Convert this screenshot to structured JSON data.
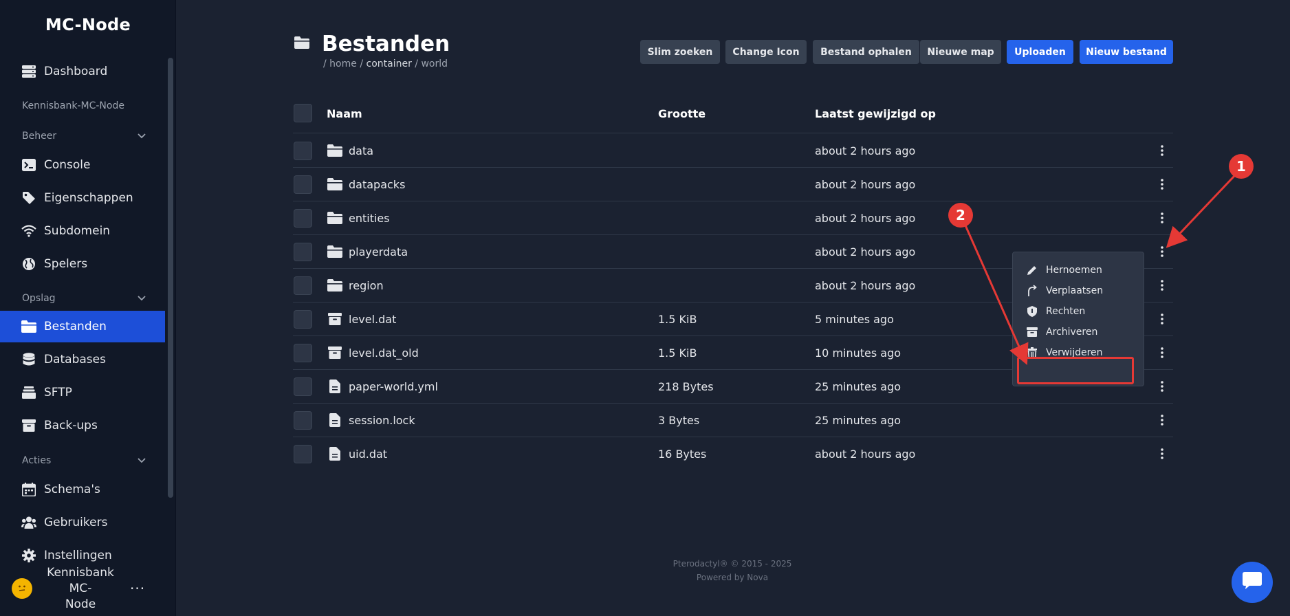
{
  "brand": "MC-Node",
  "sidebar": {
    "items": [
      {
        "label": "Dashboard",
        "icon": "server-icon"
      },
      {
        "label": "Console",
        "icon": "terminal-icon"
      },
      {
        "label": "Eigenschappen",
        "icon": "tag-icon"
      },
      {
        "label": "Subdomein",
        "icon": "wifi-icon"
      },
      {
        "label": "Spelers",
        "icon": "globe-icon"
      },
      {
        "label": "Bestanden",
        "icon": "folder-icon",
        "active": true
      },
      {
        "label": "Databases",
        "icon": "database-icon"
      },
      {
        "label": "SFTP",
        "icon": "stack-icon"
      },
      {
        "label": "Back-ups",
        "icon": "archive-icon"
      },
      {
        "label": "Schema's",
        "icon": "calendar-icon"
      },
      {
        "label": "Gebruikers",
        "icon": "users-icon"
      },
      {
        "label": "Instellingen",
        "icon": "gear-icon"
      }
    ],
    "server_name": "Kennisbank-MC-Node",
    "sections": {
      "beheer": "Beheer",
      "opslag": "Opslag",
      "acties": "Acties"
    },
    "user": {
      "name_line1": "Kennisbank MC-",
      "name_line2": "Node",
      "menu": "···"
    }
  },
  "header": {
    "title": "Bestanden",
    "breadcrumb": {
      "sep1": "/ ",
      "home": "home",
      "sep2": " / ",
      "container": "container",
      "sep3": " / ",
      "world": "world"
    }
  },
  "toolbar": {
    "smart_search": "Slim zoeken",
    "change_icon": "Change Icon",
    "fetch_file": "Bestand ophalen",
    "new_folder": "Nieuwe map",
    "upload": "Uploaden",
    "new_file": "Nieuw bestand"
  },
  "table": {
    "columns": {
      "name": "Naam",
      "size": "Grootte",
      "modified": "Laatst gewijzigd op"
    },
    "rows": [
      {
        "name": "data",
        "size": "",
        "modified": "about 2 hours ago",
        "type": "folder"
      },
      {
        "name": "datapacks",
        "size": "",
        "modified": "about 2 hours ago",
        "type": "folder"
      },
      {
        "name": "entities",
        "size": "",
        "modified": "about 2 hours ago",
        "type": "folder"
      },
      {
        "name": "playerdata",
        "size": "",
        "modified": "about 2 hours ago",
        "type": "folder"
      },
      {
        "name": "region",
        "size": "",
        "modified": "about 2 hours ago",
        "type": "folder"
      },
      {
        "name": "level.dat",
        "size": "1.5 KiB",
        "modified": "5 minutes ago",
        "type": "archive"
      },
      {
        "name": "level.dat_old",
        "size": "1.5 KiB",
        "modified": "10 minutes ago",
        "type": "archive"
      },
      {
        "name": "paper-world.yml",
        "size": "218 Bytes",
        "modified": "25 minutes ago",
        "type": "file"
      },
      {
        "name": "session.lock",
        "size": "3 Bytes",
        "modified": "25 minutes ago",
        "type": "file"
      },
      {
        "name": "uid.dat",
        "size": "16 Bytes",
        "modified": "about 2 hours ago",
        "type": "file"
      }
    ]
  },
  "context_menu": {
    "items": [
      {
        "label": "Hernoemen",
        "icon": "pencil-icon"
      },
      {
        "label": "Verplaatsen",
        "icon": "move-icon"
      },
      {
        "label": "Rechten",
        "icon": "shield-icon"
      },
      {
        "label": "Archiveren",
        "icon": "archive-icon"
      },
      {
        "label": "Verwijderen",
        "icon": "trash-icon"
      }
    ]
  },
  "annotations": {
    "marker1": "1",
    "marker2": "2",
    "color": "#e53935"
  },
  "footer": {
    "line1": "Pterodactyl® © 2015 - 2025",
    "line2": "Powered by Nova"
  },
  "colors": {
    "accent": "#2563eb",
    "sidebar_bg": "#111827",
    "main_bg": "#1b2231"
  }
}
